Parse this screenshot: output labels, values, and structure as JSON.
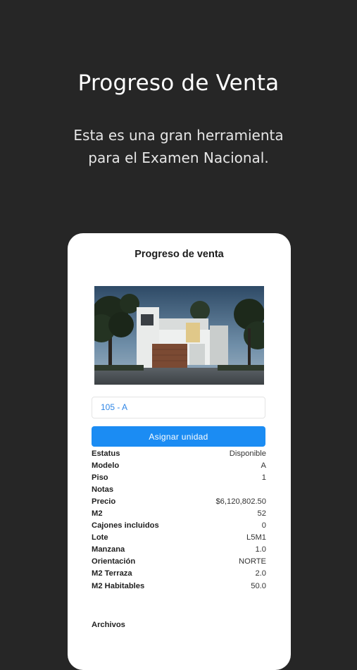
{
  "promo": {
    "title": "Progreso de Venta",
    "subtitle": "Esta es una gran herramienta\npara el Examen Nacional."
  },
  "screen": {
    "title": "Progreso de venta",
    "photo_icon": "house-photo",
    "unit_input_value": "105 - A",
    "assign_button_label": "Asignar unidad",
    "details": [
      {
        "label": "Estatus",
        "value": "Disponible"
      },
      {
        "label": "Modelo",
        "value": "A"
      },
      {
        "label": "Piso",
        "value": "1"
      },
      {
        "label": "Notas",
        "value": ""
      },
      {
        "label": "Precio",
        "value": "$6,120,802.50"
      },
      {
        "label": "M2",
        "value": "52"
      },
      {
        "label": "Cajones incluidos",
        "value": "0"
      },
      {
        "label": "Lote",
        "value": "L5M1"
      },
      {
        "label": "Manzana",
        "value": "1.0"
      },
      {
        "label": "Orientación",
        "value": "NORTE"
      },
      {
        "label": "M2 Terraza",
        "value": "2.0"
      },
      {
        "label": "M2 Habitables",
        "value": "50.0"
      }
    ],
    "files_label": "Archivos"
  },
  "colors": {
    "background": "#262626",
    "accent": "#1b8cf3",
    "input_text": "#2f86e6"
  }
}
